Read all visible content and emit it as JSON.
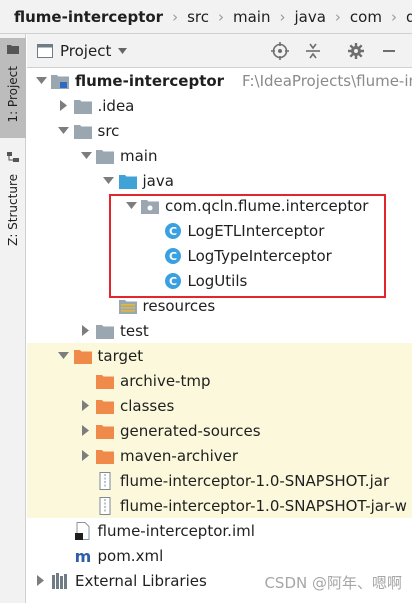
{
  "breadcrumb": [
    {
      "label": "flume-interceptor",
      "bold": true
    },
    {
      "label": "src"
    },
    {
      "label": "main"
    },
    {
      "label": "java"
    },
    {
      "label": "com"
    },
    {
      "label": "qcln"
    }
  ],
  "side_tabs": {
    "project": "1: Project",
    "structure": "Z: Structure"
  },
  "panel": {
    "title": "Project"
  },
  "tree": [
    {
      "label": "flume-interceptor",
      "bold": true,
      "path": "F:\\IdeaProjects\\flume-inte",
      "level": 0,
      "toggle": "down",
      "icon": "module-folder-icon"
    },
    {
      "label": ".idea",
      "level": 1,
      "toggle": "right",
      "icon": "folder-icon"
    },
    {
      "label": "src",
      "level": 1,
      "toggle": "down",
      "icon": "folder-icon"
    },
    {
      "label": "main",
      "level": 2,
      "toggle": "down",
      "icon": "folder-icon"
    },
    {
      "label": "java",
      "level": 3,
      "toggle": "down",
      "icon": "source-folder-icon"
    },
    {
      "label": "com.qcln.flume.interceptor",
      "level": 4,
      "toggle": "down",
      "icon": "package-icon"
    },
    {
      "label": "LogETLInterceptor",
      "level": 5,
      "toggle": "none",
      "icon": "class-icon"
    },
    {
      "label": "LogTypeInterceptor",
      "level": 5,
      "toggle": "none",
      "icon": "class-icon"
    },
    {
      "label": "LogUtils",
      "level": 5,
      "toggle": "none",
      "icon": "class-icon"
    },
    {
      "label": "resources",
      "level": 3,
      "toggle": "none",
      "icon": "resources-folder-icon"
    },
    {
      "label": "test",
      "level": 2,
      "toggle": "right",
      "icon": "folder-icon"
    },
    {
      "label": "target",
      "level": 1,
      "toggle": "down",
      "icon": "excluded-folder-icon",
      "excluded": true
    },
    {
      "label": "archive-tmp",
      "level": 2,
      "toggle": "none",
      "icon": "excluded-folder-icon",
      "excluded": true
    },
    {
      "label": "classes",
      "level": 2,
      "toggle": "right",
      "icon": "excluded-folder-icon",
      "excluded": true
    },
    {
      "label": "generated-sources",
      "level": 2,
      "toggle": "right",
      "icon": "excluded-folder-icon",
      "excluded": true
    },
    {
      "label": "maven-archiver",
      "level": 2,
      "toggle": "right",
      "icon": "excluded-folder-icon",
      "excluded": true
    },
    {
      "label": "flume-interceptor-1.0-SNAPSHOT.jar",
      "level": 2,
      "toggle": "none",
      "icon": "jar-icon",
      "excluded": true
    },
    {
      "label": "flume-interceptor-1.0-SNAPSHOT-jar-w",
      "level": 2,
      "toggle": "none",
      "icon": "jar-icon",
      "excluded": true
    },
    {
      "label": "flume-interceptor.iml",
      "level": 1,
      "toggle": "none",
      "icon": "iml-file-icon"
    },
    {
      "label": "pom.xml",
      "level": 1,
      "toggle": "none",
      "icon": "maven-icon"
    },
    {
      "label": "External Libraries",
      "level": 0,
      "toggle": "right",
      "icon": "libraries-icon"
    }
  ],
  "watermark": "CSDN @阿年、嗯啊",
  "colors": {
    "folder": "#9aa7b0",
    "source_folder": "#40a3d8",
    "excluded_folder": "#f08a4b",
    "class_circle": "#3aa1e0",
    "excluded_bg": "#fbf8db",
    "highlight_box": "#e3262d"
  }
}
